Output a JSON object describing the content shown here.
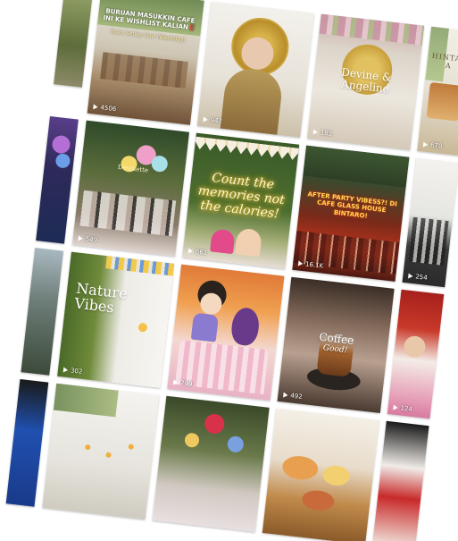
{
  "grid": {
    "tiles": [
      {
        "id": "t1",
        "overlay": "",
        "views": ""
      },
      {
        "id": "t2",
        "overlay": "BURUAN MASUKKIN CAFE INI KE WISHLIST KALIAN‼️",
        "subtext": "Buka Setiap Hari (Weekday)",
        "views": "4506"
      },
      {
        "id": "t3",
        "overlay": "",
        "views": "942"
      },
      {
        "id": "t4",
        "overlay": "Devine & Angeline",
        "views": "183"
      },
      {
        "id": "t5",
        "overlay": "HINTAL A",
        "views": "678"
      },
      {
        "id": "t6",
        "overlay": "",
        "views": ""
      },
      {
        "id": "t7",
        "overlay": "Devinette",
        "views": "549"
      },
      {
        "id": "t8",
        "overlay": "Count the memories not the calories!",
        "views": "661"
      },
      {
        "id": "t9",
        "overlay": "AFTER PARTY VIBESS?! DI CAFE GLASS HOUSE BINTARO!",
        "views": "16.1K"
      },
      {
        "id": "t10",
        "overlay": "",
        "views": "254"
      },
      {
        "id": "t11",
        "overlay": "",
        "views": ""
      },
      {
        "id": "t12",
        "overlay": "Nature Vibes",
        "views": "302"
      },
      {
        "id": "t13",
        "overlay": "",
        "views": "799"
      },
      {
        "id": "t14",
        "overlay": "Coffee",
        "subtext": "Good!",
        "views": "492"
      },
      {
        "id": "t15",
        "overlay": "",
        "views": "124"
      },
      {
        "id": "t16",
        "overlay": "",
        "views": ""
      },
      {
        "id": "t17",
        "overlay": "",
        "views": ""
      },
      {
        "id": "t18",
        "overlay": "",
        "views": ""
      },
      {
        "id": "t19",
        "overlay": "",
        "views": ""
      },
      {
        "id": "t20",
        "overlay": "",
        "views": ""
      }
    ]
  }
}
